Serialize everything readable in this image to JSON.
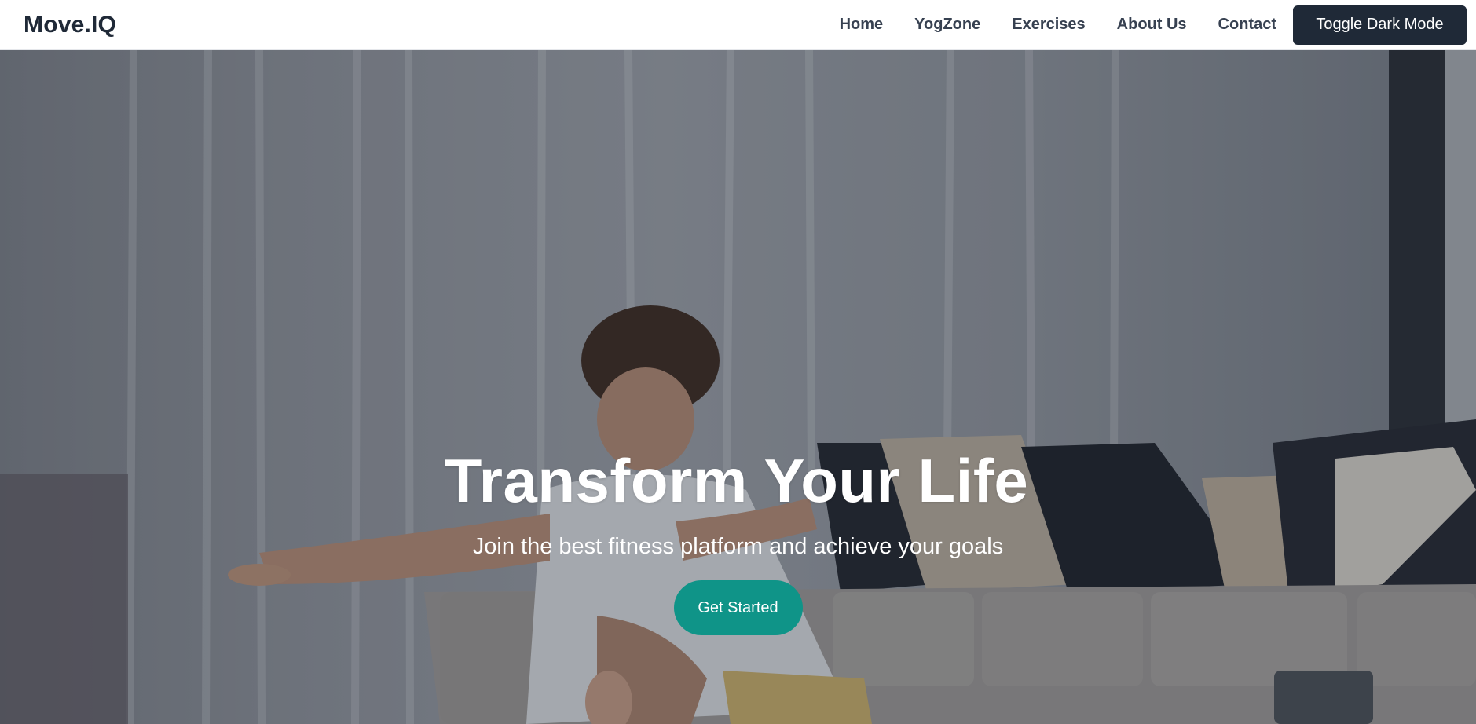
{
  "brand": {
    "logo_text": "Move.IQ"
  },
  "nav": {
    "links": [
      {
        "label": "Home"
      },
      {
        "label": "YogZone"
      },
      {
        "label": "Exercises"
      },
      {
        "label": "About Us"
      },
      {
        "label": "Contact"
      }
    ],
    "toggle_label": "Toggle Dark Mode"
  },
  "hero": {
    "title": "Transform Your Life",
    "subtitle": "Join the best fitness platform and achieve your goals",
    "cta_label": "Get Started"
  },
  "colors": {
    "nav_text": "#374151",
    "dark_button": "#1f2937",
    "accent": "#0f9488"
  }
}
